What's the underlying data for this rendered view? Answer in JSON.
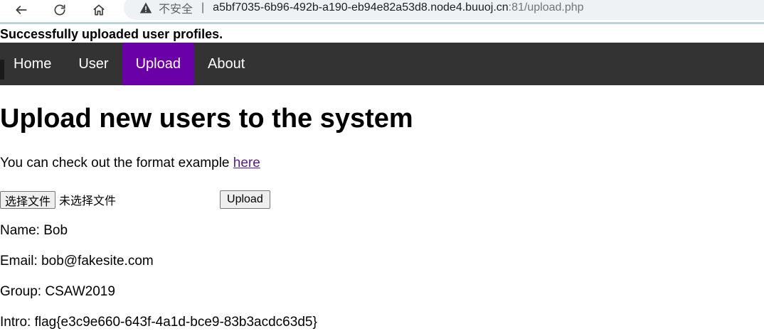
{
  "browser": {
    "security_label": "不安全",
    "separator": "|",
    "url_host": "a5bf7035-6b96-492b-a190-eb94e82a53d8.node4.buuoj.cn",
    "url_rest": ":81/upload.php"
  },
  "success_message": "Successfully uploaded user profiles.",
  "nav": {
    "tabs": [
      {
        "label": "Home"
      },
      {
        "label": "User"
      },
      {
        "label": "Upload",
        "active": true
      },
      {
        "label": "About"
      }
    ]
  },
  "page": {
    "title": "Upload new users to the system",
    "format_text": "You can check out the format example ",
    "format_link": "here"
  },
  "upload": {
    "choose_file_label": "选择文件",
    "no_file_label": "未选择文件",
    "upload_label": "Upload"
  },
  "profile": {
    "name": "Name: Bob",
    "email": "Email: bob@fakesite.com",
    "group": "Group: CSAW2019",
    "intro": "Intro: flag{e3c9e660-643f-4a1d-bce9-83b3acdc63d5}"
  },
  "colors": {
    "nav_bg": "#333333",
    "nav_active": "#6a00a8",
    "link": "#551a8b"
  }
}
